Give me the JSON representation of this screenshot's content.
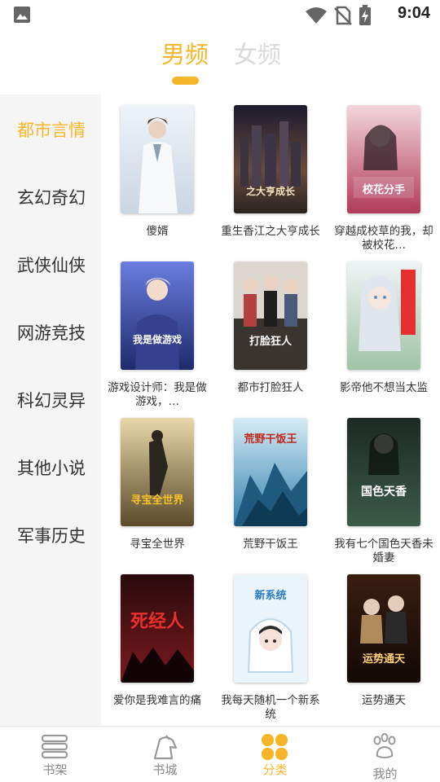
{
  "status_bar": {
    "time": "9:04"
  },
  "gender_tabs": [
    {
      "label": "男频",
      "active": true
    },
    {
      "label": "女频",
      "active": false
    }
  ],
  "categories": [
    {
      "label": "都市言情",
      "active": true
    },
    {
      "label": "玄幻奇幻",
      "active": false
    },
    {
      "label": "武侠仙侠",
      "active": false
    },
    {
      "label": "网游竞技",
      "active": false
    },
    {
      "label": "科幻灵异",
      "active": false
    },
    {
      "label": "其他小说",
      "active": false
    },
    {
      "label": "军事历史",
      "active": false
    }
  ],
  "books": [
    {
      "title": "傻婿",
      "cover_text": ""
    },
    {
      "title": "重生香江之大亨成长",
      "cover_text": "之大亨成长"
    },
    {
      "title": "穿越成校草的我，却被校花…",
      "cover_text": "校花分手"
    },
    {
      "title": "游戏设计师：我是做游戏，…",
      "cover_text": "我是做游戏"
    },
    {
      "title": "都市打脸狂人",
      "cover_text": "打脸狂人"
    },
    {
      "title": "影帝他不想当太监",
      "cover_text": ""
    },
    {
      "title": "寻宝全世界",
      "cover_text": "寻宝全世界"
    },
    {
      "title": "荒野干饭王",
      "cover_text": "荒野干饭王"
    },
    {
      "title": "我有七个国色天香未婚妻",
      "cover_text": "国色天香"
    },
    {
      "title": "爱你是我难言的痛",
      "cover_text": "死经人"
    },
    {
      "title": "我每天随机一个新系统",
      "cover_text": "新系统"
    },
    {
      "title": "运势通天",
      "cover_text": "运势通天"
    }
  ],
  "bottom_nav": [
    {
      "label": "书架",
      "icon": "bookshelf-icon",
      "active": false
    },
    {
      "label": "书城",
      "icon": "bookstore-icon",
      "active": false
    },
    {
      "label": "分类",
      "icon": "category-icon",
      "active": true
    },
    {
      "label": "我的",
      "icon": "profile-icon",
      "active": false
    }
  ],
  "colors": {
    "accent": "#f7b62a",
    "sidebar_bg": "#f5f5f5",
    "inactive_text": "#888888"
  }
}
